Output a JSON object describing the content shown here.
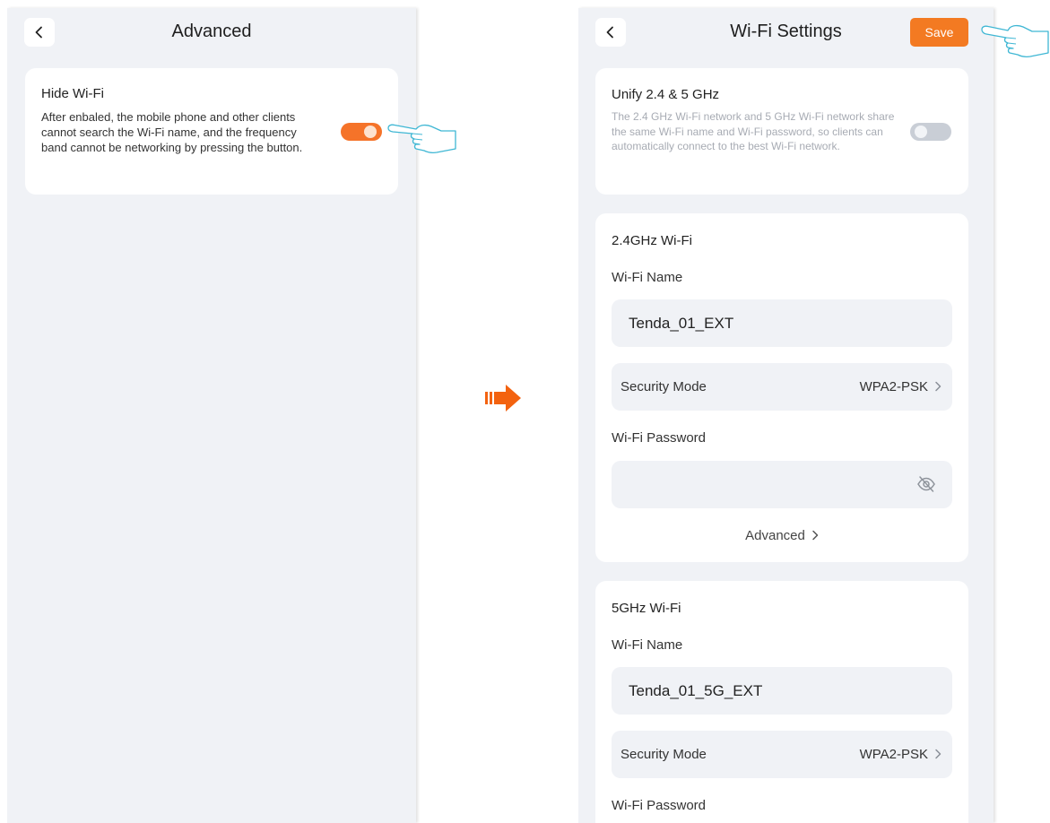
{
  "left_screen": {
    "title": "Advanced",
    "back_icon": "chevron-left-icon",
    "hide_wifi": {
      "label": "Hide Wi-Fi",
      "description": "After enbaled, the mobile phone and other clients cannot search the Wi-Fi name, and the frequency band cannot be networking by pressing the button.",
      "enabled": true
    }
  },
  "right_screen": {
    "title": "Wi-Fi Settings",
    "back_icon": "chevron-left-icon",
    "save_label": "Save",
    "unify": {
      "label": "Unify 2.4 & 5 GHz",
      "description": "The 2.4 GHz Wi-Fi network and 5 GHz Wi-Fi network share the same Wi-Fi name and Wi-Fi password, so clients can automatically connect to the best Wi-Fi network.",
      "enabled": false
    },
    "band_24": {
      "title": "2.4GHz Wi-Fi",
      "name_label": "Wi-Fi Name",
      "name_value": "Tenda_01_EXT",
      "security_label": "Security Mode",
      "security_value": "WPA2-PSK",
      "password_label": "Wi-Fi Password",
      "password_value": "",
      "advanced_label": "Advanced"
    },
    "band_5": {
      "title": "5GHz Wi-Fi",
      "name_label": "Wi-Fi Name",
      "name_value": "Tenda_01_5G_EXT",
      "security_label": "Security Mode",
      "security_value": "WPA2-PSK",
      "password_label": "Wi-Fi Password"
    }
  },
  "colors": {
    "accent": "#f37a22",
    "toggle_on": "#f57329",
    "toggle_off": "#c9ced6",
    "page_bg": "#f0f2f6",
    "card_bg": "#ffffff"
  },
  "icons": [
    "chevron-left-icon",
    "chevron-right-icon",
    "eye-off-icon",
    "arrow-right-icon",
    "hand-pointer-icon"
  ]
}
